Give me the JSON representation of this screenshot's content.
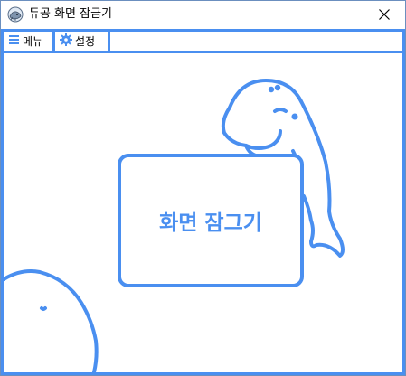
{
  "window": {
    "title": "듀공 화면 잠금기"
  },
  "toolbar": {
    "menu_label": "메뉴",
    "settings_label": "설정"
  },
  "main": {
    "lock_button_label": "화면 잠그기"
  },
  "icons": {
    "app": "dugong-app-icon",
    "close": "close-icon",
    "menu": "hamburger-menu-icon",
    "settings": "gear-icon"
  },
  "colors": {
    "accent": "#4a8ff0",
    "window_border": "#6b8fbf",
    "background": "#ffffff",
    "text": "#000000"
  }
}
